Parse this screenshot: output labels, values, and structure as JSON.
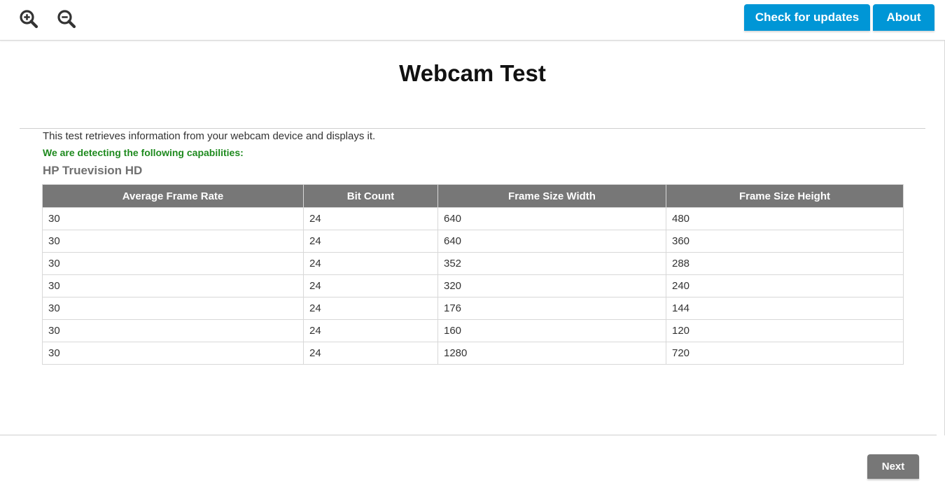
{
  "toolbar": {
    "zoom_in_icon": "zoom-in-icon",
    "zoom_out_icon": "zoom-out-icon",
    "check_updates_label": "Check for updates",
    "about_label": "About",
    "accent_color": "#0096d6"
  },
  "page": {
    "title": "Webcam Test",
    "intro": "This test retrieves information from your webcam device and displays it.",
    "detecting": "We are detecting the following capabilities:",
    "device_name": "HP Truevision HD",
    "detecting_color": "#1e8a1e"
  },
  "table": {
    "headers": [
      "Average Frame Rate",
      "Bit Count",
      "Frame Size Width",
      "Frame Size Height"
    ],
    "rows": [
      [
        "30",
        "24",
        "640",
        "480"
      ],
      [
        "30",
        "24",
        "640",
        "360"
      ],
      [
        "30",
        "24",
        "352",
        "288"
      ],
      [
        "30",
        "24",
        "320",
        "240"
      ],
      [
        "30",
        "24",
        "176",
        "144"
      ],
      [
        "30",
        "24",
        "160",
        "120"
      ],
      [
        "30",
        "24",
        "1280",
        "720"
      ]
    ]
  },
  "footer": {
    "next_label": "Next"
  }
}
